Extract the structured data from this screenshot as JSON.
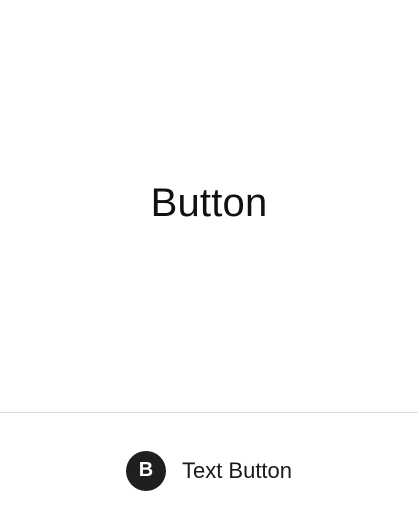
{
  "preview": {
    "title": "Button"
  },
  "footer": {
    "badge_letter": "B",
    "badge_icon": "letter-b-badge-icon",
    "button_label": "Text Button",
    "badge_color": "#1f1f1f",
    "divider_color": "#dcdcdc"
  }
}
